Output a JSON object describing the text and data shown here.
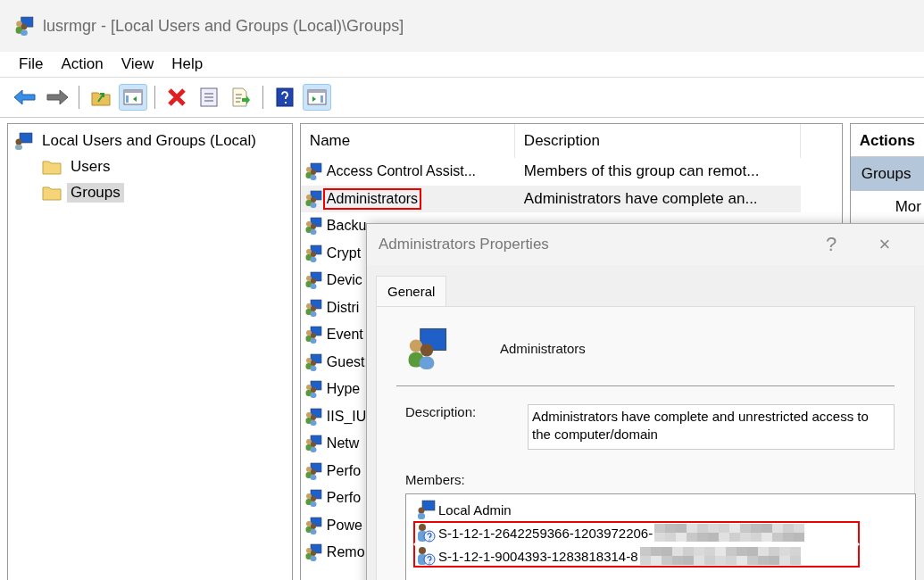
{
  "window": {
    "title": "lusrmgr - [Local Users and Groups (Local)\\Groups]"
  },
  "menu": [
    "File",
    "Action",
    "View",
    "Help"
  ],
  "toolbar": [
    {
      "kind": "back",
      "pressed": false
    },
    {
      "kind": "forward",
      "pressed": false
    },
    {
      "kind": "separator"
    },
    {
      "kind": "up",
      "pressed": false
    },
    {
      "kind": "tree",
      "pressed": true
    },
    {
      "kind": "separator"
    },
    {
      "kind": "delete",
      "pressed": false
    },
    {
      "kind": "properties",
      "pressed": false
    },
    {
      "kind": "export",
      "pressed": false
    },
    {
      "kind": "separator"
    },
    {
      "kind": "help",
      "pressed": false
    },
    {
      "kind": "actionpane",
      "pressed": true
    }
  ],
  "tree": {
    "label": "Local Users and Groups (Local)",
    "children": [
      {
        "label": "Users",
        "selected": false
      },
      {
        "label": "Groups",
        "selected": true
      }
    ]
  },
  "table": {
    "columns": [
      "Name",
      "Description"
    ],
    "rows": [
      {
        "name": "Access Control Assist...",
        "description": "Members of this group can remot...",
        "selected": false,
        "highlighted": false
      },
      {
        "name": "Administrators",
        "description": "Administrators have complete an...",
        "selected": true,
        "highlighted": true
      },
      {
        "name": "Backu",
        "selected": false,
        "highlighted": false
      },
      {
        "name": "Crypt",
        "selected": false,
        "highlighted": false
      },
      {
        "name": "Devic",
        "selected": false,
        "highlighted": false
      },
      {
        "name": "Distri",
        "selected": false,
        "highlighted": false
      },
      {
        "name": "Event",
        "selected": false,
        "highlighted": false
      },
      {
        "name": "Guest",
        "selected": false,
        "highlighted": false
      },
      {
        "name": "Hype",
        "selected": false,
        "highlighted": false
      },
      {
        "name": "IIS_IU",
        "selected": false,
        "highlighted": false
      },
      {
        "name": "Netw",
        "selected": false,
        "highlighted": false
      },
      {
        "name": "Perfo",
        "selected": false,
        "highlighted": false
      },
      {
        "name": "Perfo",
        "selected": false,
        "highlighted": false
      },
      {
        "name": "Powe",
        "selected": false,
        "highlighted": false
      },
      {
        "name": "Remo",
        "selected": false,
        "highlighted": false
      }
    ]
  },
  "actions": {
    "title": "Actions",
    "section": "Groups",
    "items": [
      "Mor"
    ]
  },
  "dialog": {
    "title": "Administrators Properties",
    "help": "?",
    "close": "×",
    "tabs": [
      {
        "label": "General",
        "selected": true
      }
    ],
    "group_name": "Administrators",
    "description_label": "Description:",
    "description": "Administrators have complete and unrestricted access to the computer/domain",
    "members_label": "Members:",
    "members": [
      {
        "kind": "user",
        "name": "Local Admin",
        "redacted": false,
        "highlighted": false
      },
      {
        "kind": "unknown",
        "name": "S-1-12-1-2642259366-1203972206-",
        "redacted": true,
        "highlighted": true
      },
      {
        "kind": "unknown",
        "name": "S-1-12-1-9004393-1283818314-8",
        "redacted": true,
        "highlighted": true
      }
    ]
  }
}
